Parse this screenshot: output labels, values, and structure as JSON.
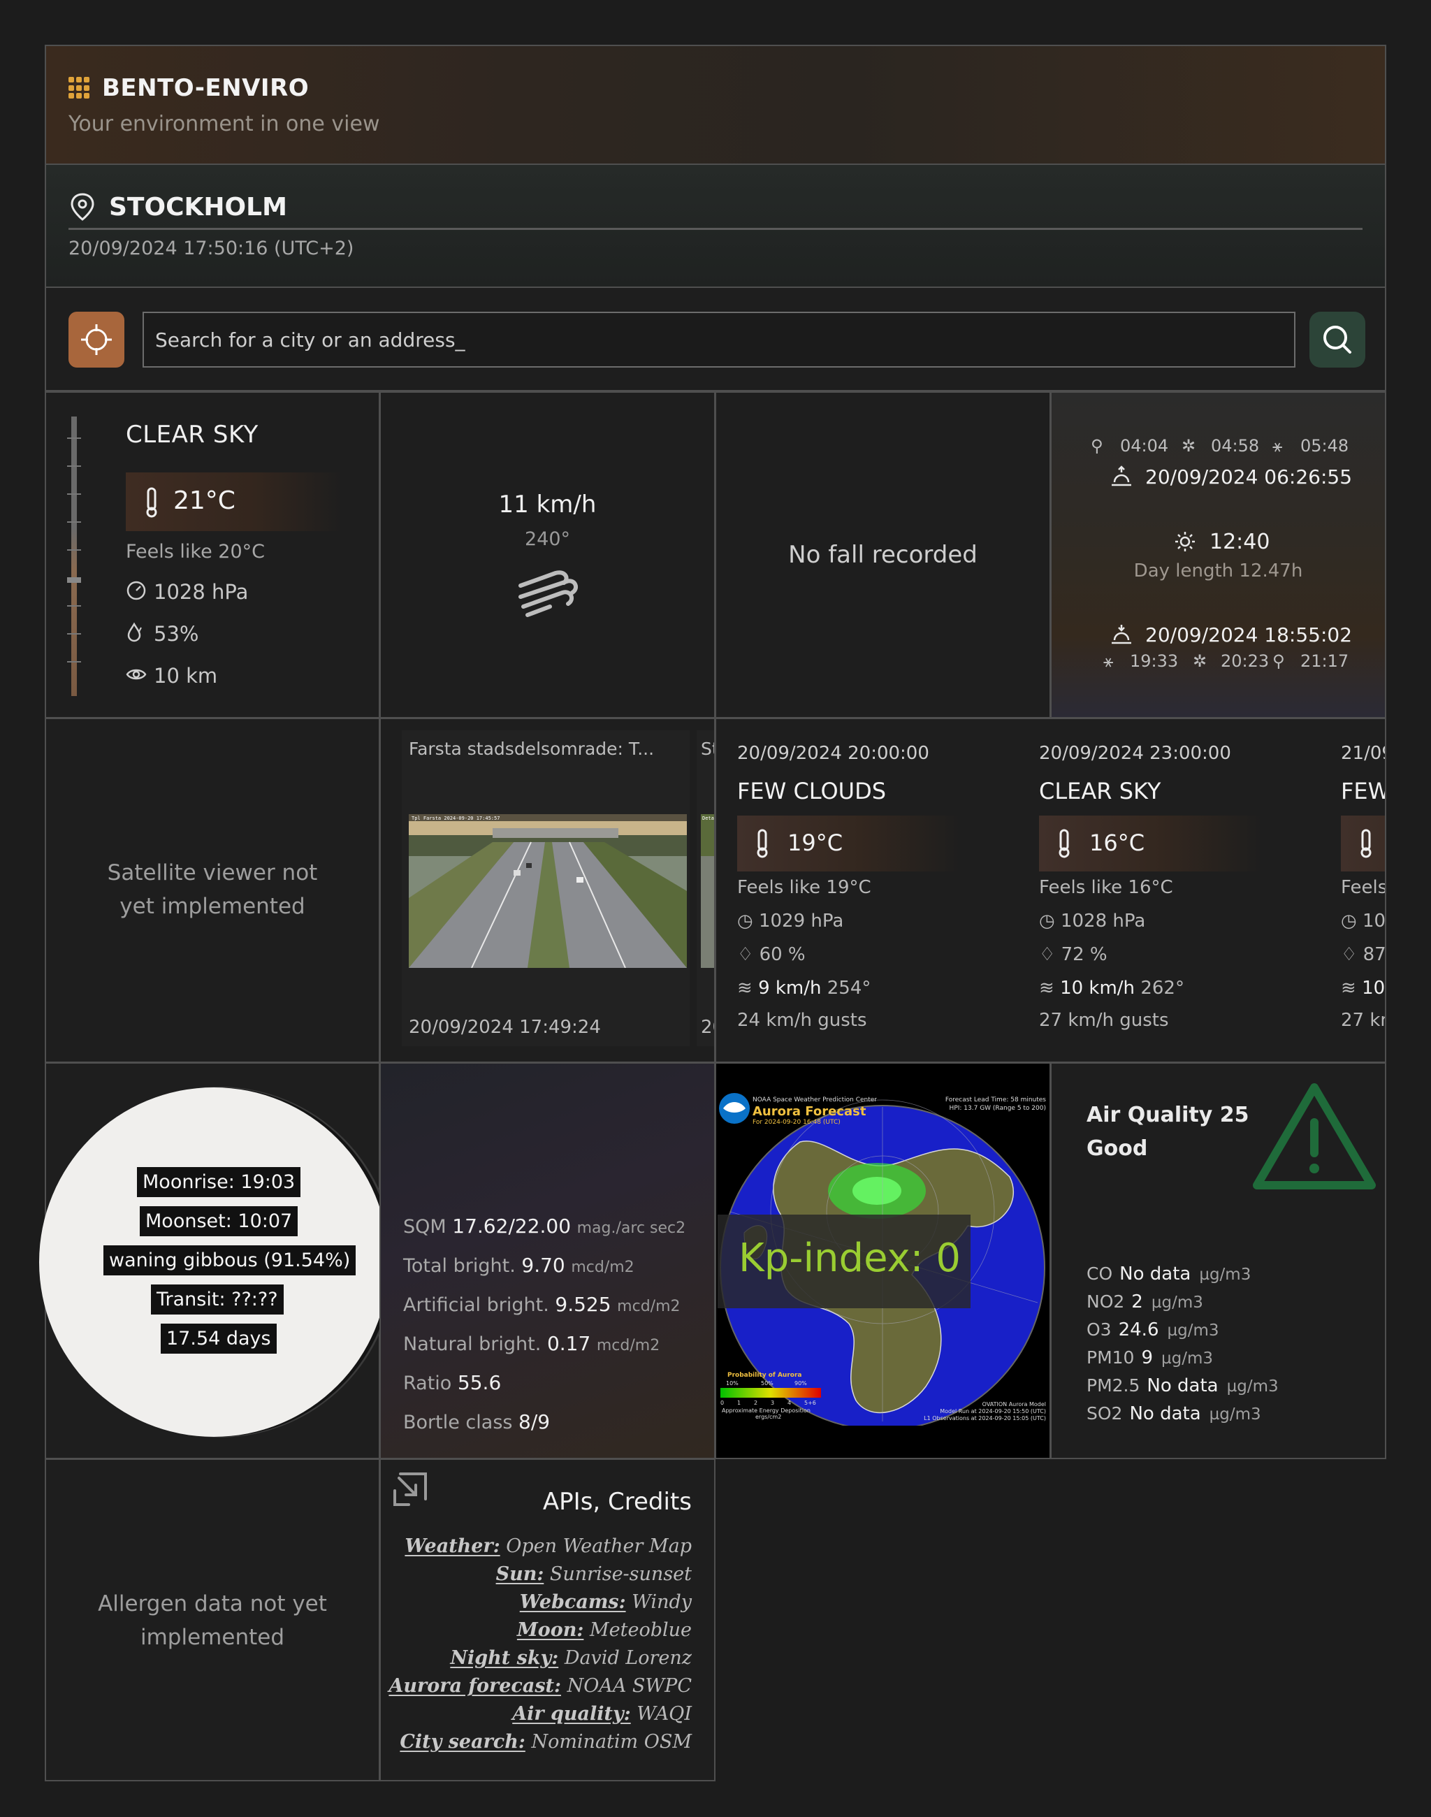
{
  "app": {
    "title": "BENTO-ENVIRO",
    "subtitle": "Your environment in one view"
  },
  "location": {
    "city": "STOCKHOLM",
    "datetime": "20/09/2024 17:50:16 (UTC+2)"
  },
  "search": {
    "placeholder": "Search for a city or an address_"
  },
  "weather": {
    "condition": "CLEAR SKY",
    "temp": "21°C",
    "feels_like": "Feels like 20°C",
    "pressure": "1028 hPa",
    "humidity": "53%",
    "visibility": "10 km"
  },
  "wind": {
    "speed": "11 km/h",
    "direction": "240°"
  },
  "precip": {
    "text": "No fall recorded"
  },
  "sun": {
    "astro_dawn": "04:04",
    "nautical_dawn": "04:58",
    "civil_dawn": "05:48",
    "sunrise": "20/09/2024 06:26:55",
    "noon": "12:40",
    "day_length": "Day length 12.47h",
    "sunset": "20/09/2024 18:55:02",
    "civil_dusk": "19:33",
    "nautical_dusk": "20:23",
    "astro_dusk": "21:17"
  },
  "satellite": {
    "text": "Satellite viewer not yet implemented"
  },
  "webcams": [
    {
      "title": "Farsta stadsdelsomrade: T...",
      "timestamp": "20/09/2024 17:49:24",
      "overlay": "Tpl Farsta 2024-09-20 17:45:57"
    },
    {
      "title": "St",
      "timestamp": "20",
      "overlay": "Detalj"
    }
  ],
  "forecast": [
    {
      "date": "20/09/2024 20:00:00",
      "condition": "FEW CLOUDS",
      "temp": "19°C",
      "feels": "Feels like 19°C",
      "pressure": "1029 hPa",
      "humidity": "60 %",
      "wind": "9 km/h",
      "wind_dir": "254°",
      "gusts": "24 km/h gusts"
    },
    {
      "date": "20/09/2024 23:00:00",
      "condition": "CLEAR SKY",
      "temp": "16°C",
      "feels": "Feels like 16°C",
      "pressure": "1028 hPa",
      "humidity": "72 %",
      "wind": "10 km/h",
      "wind_dir": "262°",
      "gusts": "27 km/h gusts"
    },
    {
      "date": "21/09",
      "condition": "FEW",
      "temp": "",
      "feels": "Feels",
      "pressure": "10",
      "humidity": "87",
      "wind": "10",
      "wind_dir": "",
      "gusts": "27 km"
    }
  ],
  "moon": {
    "moonrise": "Moonrise: 19:03",
    "moonset": "Moonset: 10:07",
    "phase": "waning gibbous (91.54%)",
    "transit": "Transit: ??:??",
    "age": "17.54 days"
  },
  "sky": {
    "sqm_label": "SQM",
    "sqm": "17.62/22.00",
    "sqm_unit": "mag./arc sec2",
    "total_label": "Total bright.",
    "total": "9.70",
    "total_unit": "mcd/m2",
    "artificial_label": "Artificial bright.",
    "artificial": "9.525",
    "artificial_unit": "mcd/m2",
    "natural_label": "Natural bright.",
    "natural": "0.17",
    "natural_unit": "mcd/m2",
    "ratio_label": "Ratio",
    "ratio": "55.6",
    "bortle_label": "Bortle class",
    "bortle": "8/9"
  },
  "aurora": {
    "kp": "Kp-index: 0",
    "header_left": "NOAA Space Weather Prediction Center",
    "title": "Aurora Forecast",
    "for_date": "For 2024-09-20 16:48 (UTC)",
    "lead": "Forecast Lead Time:  58 minutes",
    "hpi": "HPI:  13.7 GW (Range 5 to 200)",
    "prob_label": "Probability of Aurora",
    "prob_ticks": [
      "10%",
      "50%",
      "90%"
    ],
    "scale_ticks": [
      "0",
      "1",
      "2",
      "3",
      "4",
      "5+6"
    ],
    "energy_label": "Approximate Energy Deposition",
    "energy_unit": "ergs/cm2",
    "model": "OVATION Aurora Model",
    "run": "Model Run at 2024-09-20 15:50 (UTC)",
    "obs": "L1 Observations at 2024-09-20 15:05 (UTC)"
  },
  "air": {
    "title_line1": "Air Quality 25",
    "title_line2": "Good",
    "pollutants": [
      {
        "name": "CO",
        "value": "No data",
        "unit": "µg/m3"
      },
      {
        "name": "NO2",
        "value": "2",
        "unit": "µg/m3"
      },
      {
        "name": "O3",
        "value": "24.6",
        "unit": "µg/m3"
      },
      {
        "name": "PM10",
        "value": "9",
        "unit": "µg/m3"
      },
      {
        "name": "PM2.5",
        "value": "No data",
        "unit": "µg/m3"
      },
      {
        "name": "SO2",
        "value": "No data",
        "unit": "µg/m3"
      }
    ],
    "status_color": "#1f6b3a"
  },
  "allergen": {
    "text": "Allergen data not yet implemented"
  },
  "credits": {
    "title": "APIs, Credits",
    "items": [
      {
        "label": "Weather:",
        "source": "Open Weather Map"
      },
      {
        "label": "Sun:",
        "source": "Sunrise-sunset"
      },
      {
        "label": "Webcams:",
        "source": "Windy"
      },
      {
        "label": "Moon:",
        "source": "Meteoblue"
      },
      {
        "label": "Night sky:",
        "source": "David Lorenz"
      },
      {
        "label": "Aurora forecast:",
        "source": "NOAA SWPC"
      },
      {
        "label": "Air quality:",
        "source": "WAQI"
      },
      {
        "label": "City search:",
        "source": "Nominatim OSM"
      }
    ]
  },
  "colors": {
    "accent": "#e0a33a",
    "locate": "#a8663c",
    "search": "#2c4438",
    "kp": "#9acd32"
  }
}
